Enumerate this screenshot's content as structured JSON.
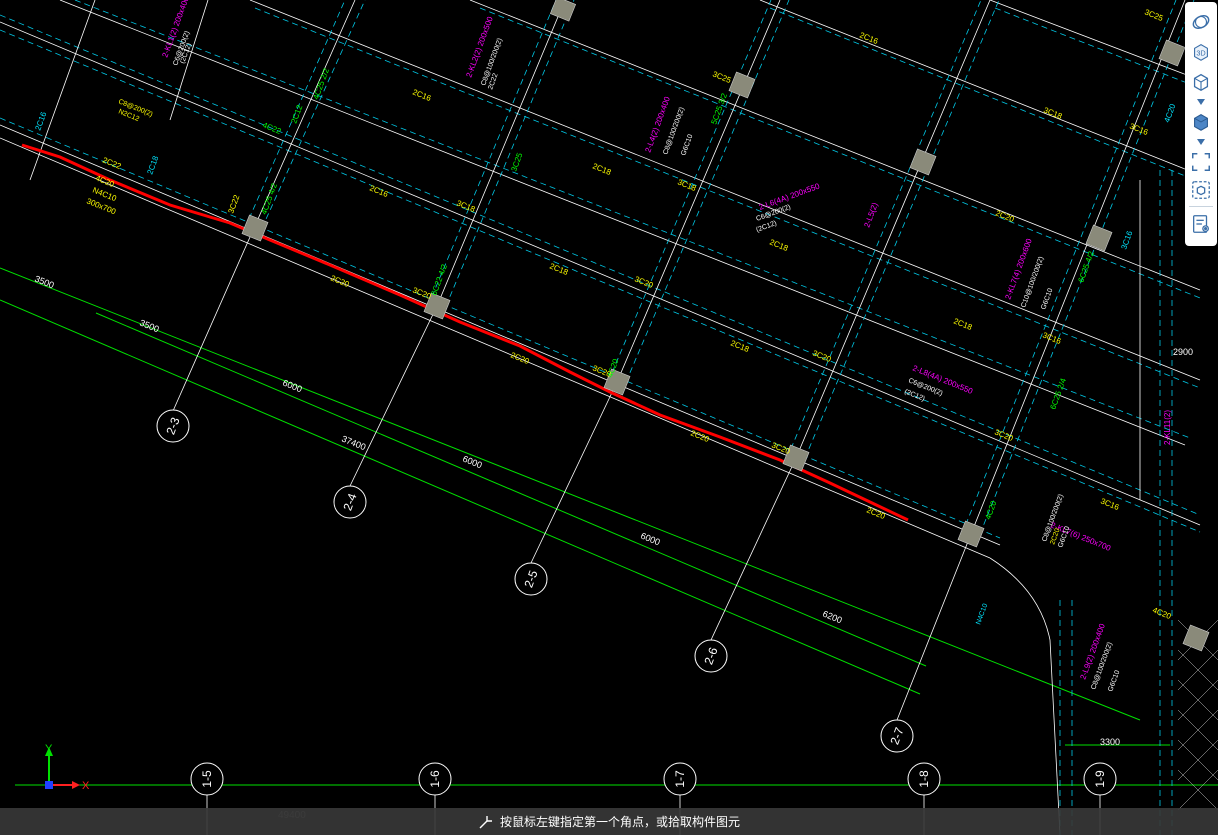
{
  "drawing": {
    "axes": [
      "2-3",
      "2-4",
      "2-5",
      "2-6",
      "2-7",
      "1-5",
      "1-6",
      "1-7",
      "1-8",
      "1-9"
    ],
    "dims": [
      "3500",
      "3500",
      "6000",
      "37400",
      "6000",
      "6000",
      "6200",
      "2900",
      "3300"
    ],
    "beam_labels": [
      "2C22",
      "4C20",
      "N4C10",
      "300x700",
      "2C20",
      "2C20",
      "2C20",
      "2C20",
      "2C20",
      "2C16",
      "2C16",
      "2C16",
      "2C18",
      "2C18",
      "2C18",
      "2C18",
      "2C18",
      "3C22",
      "3C20",
      "3C20",
      "3C20",
      "3C20",
      "3C20",
      "3C20",
      "3C18",
      "3C18",
      "3C18",
      "3C16",
      "3C16",
      "3C16",
      "4C22",
      "4C25 2/2",
      "5C25 3/2",
      "6C25 2/4",
      "6C25 4/2",
      "6C22 4/2",
      "4C25 4/2",
      "4C20",
      "4C20",
      "2C12",
      "3C25",
      "3C25",
      "3C25",
      "4C20"
    ],
    "span_labels": [
      "2-KL1(2) 200x400",
      "2-KL2(2) 200x500",
      "2-L6(4A) 200x550",
      "2-L5(2)",
      "2-L8(4A) 200x550",
      "2-KL7(4) 200x600",
      "2-KL7(6) 250x700",
      "2-L9(2) 200x400",
      "2-L4(2) 200x400",
      "2-KL11(2)"
    ],
    "stirrup_labels": [
      "C8@200(2)",
      "N2C12",
      "C8@100/200(2)",
      "2C22",
      "(2C12)",
      "C6@200(2)",
      "C10@100/200(2)",
      "G6C10",
      "C6@200(2)",
      "(2C12)",
      "C8@100/200(2)",
      "G6C10",
      "C6@200(2)",
      "(2C12)",
      "C8@100/200(2)",
      "2C20",
      "G6C10",
      "C8@100/200(2)",
      "G6C10",
      "N4C10"
    ],
    "ucs": {
      "y_label": "Y",
      "x_label": "X"
    },
    "bottom_dim": "49400"
  },
  "toolbar": {
    "items": [
      {
        "name": "orbit-icon"
      },
      {
        "name": "3d-view-icon",
        "label": "3D"
      },
      {
        "name": "view-cube-icon"
      },
      {
        "name": "solid-view-icon"
      },
      {
        "name": "fullscreen-icon"
      },
      {
        "name": "component-view-icon"
      },
      {
        "name": "properties-view-icon"
      }
    ]
  },
  "status": {
    "prompt": "按鼠标左键指定第一个角点，或拾取构件图元"
  },
  "colors": {
    "background": "#000000",
    "beam_line": "#ffffff",
    "beam_dash": "#00c8e6",
    "axis_line": "#00e000",
    "text_yellow": "#ffff00",
    "text_magenta": "#ff00ff",
    "text_green": "#00ff00",
    "text_cyan": "#00e5ff",
    "selection_red": "#ff0000",
    "column_fill": "#8a8a7a"
  }
}
